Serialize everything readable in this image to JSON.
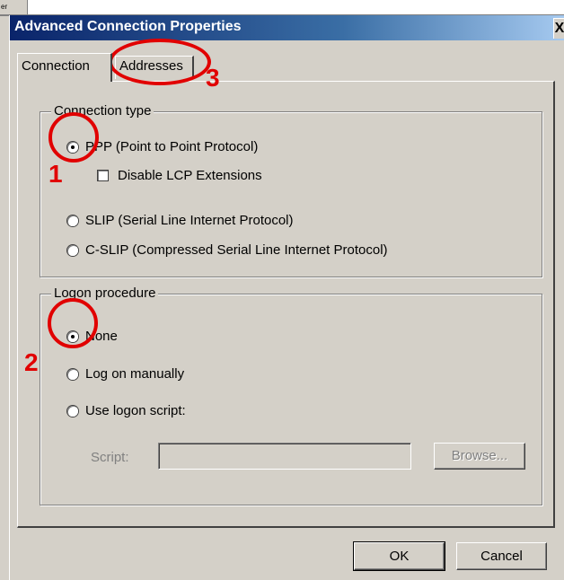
{
  "background": {
    "fragment_text": "er"
  },
  "dialog": {
    "title": "Advanced Connection Properties",
    "close_glyph": "X"
  },
  "tabs": [
    {
      "label": "Connection",
      "active": true
    },
    {
      "label": "Addresses",
      "active": false
    }
  ],
  "connection_type": {
    "legend": "Connection type",
    "options": [
      {
        "label": "PPP (Point to Point Protocol)",
        "checked": true
      },
      {
        "label": "SLIP (Serial Line Internet Protocol)",
        "checked": false
      },
      {
        "label": "C-SLIP (Compressed Serial Line Internet Protocol)",
        "checked": false
      }
    ],
    "disable_lcp_label": "Disable LCP Extensions",
    "disable_lcp_checked": false
  },
  "logon_procedure": {
    "legend": "Logon procedure",
    "options": [
      {
        "label": "None",
        "checked": true
      },
      {
        "label": "Log on manually",
        "checked": false
      },
      {
        "label": "Use logon script:",
        "checked": false
      }
    ],
    "script_label": "Script:",
    "script_value": "",
    "browse_label": "Browse..."
  },
  "buttons": {
    "ok": "OK",
    "cancel": "Cancel"
  },
  "annotations": [
    {
      "number": "1",
      "target": "PPP radio"
    },
    {
      "number": "2",
      "target": "None radio"
    },
    {
      "number": "3",
      "target": "Addresses tab"
    }
  ],
  "colors": {
    "annotation": "#e10000",
    "title_bar": "#0a246a",
    "dialog_bg": "#d4d0c8"
  }
}
